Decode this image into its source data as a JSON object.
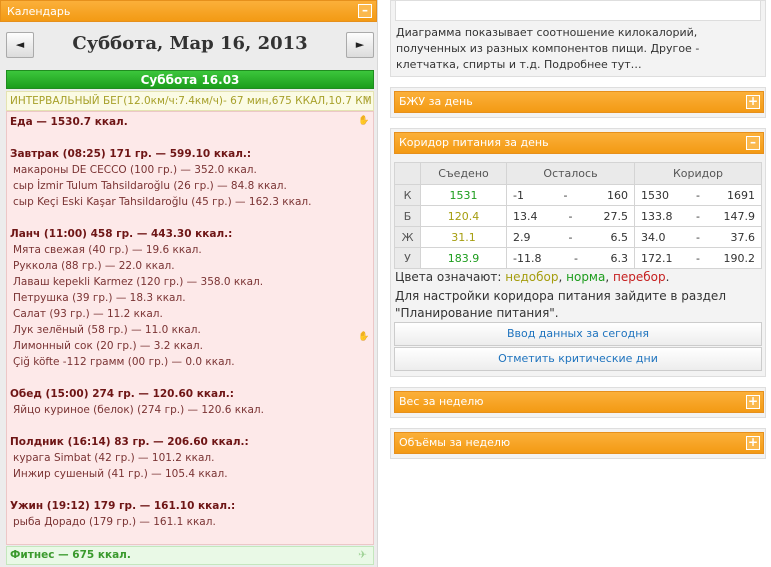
{
  "calendar": {
    "header": "Календарь",
    "collapse": "–",
    "prev": "◄",
    "next": "►",
    "date_title": "Суббота, Мар 16, 2013",
    "day_header": "Суббота 16.03"
  },
  "interval": {
    "text": "ИНТЕРВАЛЬНЫЙ БЕГ(12.0км/ч:7.4км/ч)- 67 мин,675 ККАЛ,10.7 КМ",
    "mark": "!"
  },
  "food_lines": [
    {
      "type": "head",
      "text": "Еда — 1530.7 ккал."
    },
    {
      "type": "blank",
      "text": ""
    },
    {
      "type": "head",
      "text": "Завтрак (08:25) 171 гр. — 599.10 ккал.:"
    },
    {
      "type": "item",
      "text": "макароны DE CECCO (100 гр.) — 352.0 ккал."
    },
    {
      "type": "item",
      "text": "сыр İzmir Tulum Tahsildaroğlu (26 гр.) — 84.8 ккал."
    },
    {
      "type": "item",
      "text": "сыр Keçi Eski Kaşar Tahsildaroğlu (45 гр.) — 162.3 ккал."
    },
    {
      "type": "blank",
      "text": ""
    },
    {
      "type": "head",
      "text": "Ланч (11:00) 458 гр. — 443.30 ккал.:"
    },
    {
      "type": "item",
      "text": "Мята свежая (40 гр.) — 19.6 ккал."
    },
    {
      "type": "item",
      "text": "Руккола (88 гр.) — 22.0 ккал."
    },
    {
      "type": "item",
      "text": "Лаваш kepekli Karmez (120 гр.) — 358.0 ккал."
    },
    {
      "type": "item",
      "text": "Петрушка (39 гр.) — 18.3 ккал."
    },
    {
      "type": "item",
      "text": "Салат (93 гр.) — 11.2 ккал."
    },
    {
      "type": "item",
      "text": "Лук зелёный (58 гр.) — 11.0 ккал."
    },
    {
      "type": "item",
      "text": "Лимонный сок (20 гр.) — 3.2 ккал."
    },
    {
      "type": "item",
      "text": "Çiğ köfte -112 грамм (00 гр.) — 0.0 ккал."
    },
    {
      "type": "blank",
      "text": ""
    },
    {
      "type": "head",
      "text": "Обед (15:00) 274 гр. — 120.60 ккал.:"
    },
    {
      "type": "item",
      "text": "Яйцо куриное (белок) (274 гр.) — 120.6 ккал."
    },
    {
      "type": "blank",
      "text": ""
    },
    {
      "type": "head",
      "text": "Полдник (16:14) 83 гр. — 206.60 ккал.:"
    },
    {
      "type": "item",
      "text": "курага Simbat (42 гр.) — 101.2 ккал."
    },
    {
      "type": "item",
      "text": "Инжир сушеный (41 гр.) — 105.4 ккал."
    },
    {
      "type": "blank",
      "text": ""
    },
    {
      "type": "head",
      "text": "Ужин (19:12) 179 гр. — 161.10 ккал.:"
    },
    {
      "type": "item",
      "text": "рыба Дорадо (179 гр.) — 161.1 ккал."
    }
  ],
  "fitness": {
    "text": "Фитнес — 675 ккал."
  },
  "right": {
    "description": "Диаграмма показывает соотношение килокалорий, полученных из разных компонентов пищи. Другое - клетчатка, спирты и т.д. Подробнее тут…",
    "bju_header": "БЖУ за день",
    "corridor_header": "Коридор питания за день",
    "expand": "+",
    "collapse": "–",
    "table": {
      "headers": [
        "Съедено",
        "Осталось",
        "Коридор"
      ],
      "rows": [
        {
          "label": "К",
          "eaten": "1531",
          "left_from": "-1",
          "left_to": "160",
          "corr_from": "1530",
          "corr_to": "1691",
          "color": "#1c9c1c"
        },
        {
          "label": "Б",
          "eaten": "120.4",
          "left_from": "13.4",
          "left_to": "27.5",
          "corr_from": "133.8",
          "corr_to": "147.9",
          "color": "#a59d0e"
        },
        {
          "label": "Ж",
          "eaten": "31.1",
          "left_from": "2.9",
          "left_to": "6.5",
          "corr_from": "34.0",
          "corr_to": "37.6",
          "color": "#a59d0e"
        },
        {
          "label": "У",
          "eaten": "183.9",
          "left_from": "-11.8",
          "left_to": "6.3",
          "corr_from": "172.1",
          "corr_to": "190.2",
          "color": "#1c9c1c"
        }
      ],
      "dash": "-"
    },
    "legend_prefix": "Цвета означают: ",
    "legend_under": "недобор",
    "legend_sep": ", ",
    "legend_norm": "норма",
    "legend_over": "перебор",
    "legend_end": ".",
    "hint": "Для настройки коридора питания зайдите в раздел \"Планирование питания\".",
    "btn_today": "Ввод данных за сегодня",
    "btn_critical": "Отметить критические дни",
    "weight_header": "Вес за неделю",
    "volumes_header": "Объёмы за неделю"
  }
}
